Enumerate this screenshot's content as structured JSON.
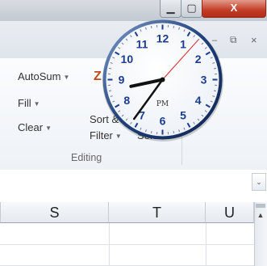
{
  "window": {
    "min_glyph": "▁",
    "max_glyph": "▢",
    "close_glyph": "X",
    "doc_min_glyph": "–",
    "doc_restore_glyph": "⧉",
    "doc_close_glyph": "×"
  },
  "ribbon": {
    "autosum_label": "AutoSum",
    "fill_label": "Fill",
    "clear_label": "Clear",
    "sort_label": "Sort &",
    "filter_label": "Filter",
    "select_label": "Select",
    "group_label": "Editing",
    "dropdown_glyph": "▼",
    "sort_glyph": "Z"
  },
  "formula_bar": {
    "expand_glyph": "⌄"
  },
  "sheet": {
    "columns": [
      "S",
      "T",
      "U"
    ]
  },
  "scrollbar": {
    "up_glyph": "▲"
  },
  "clock": {
    "numbers": [
      "12",
      "1",
      "2",
      "3",
      "4",
      "5",
      "6",
      "7",
      "8",
      "9",
      "10",
      "11"
    ],
    "period": "PM",
    "hour": 8,
    "minute": 36,
    "second": 7,
    "colors": {
      "face": "#ffffff",
      "rim": "#1f3f7a",
      "numerals": "#1b3d8f",
      "second_hand": "#e02020",
      "hands": "#111111"
    }
  }
}
